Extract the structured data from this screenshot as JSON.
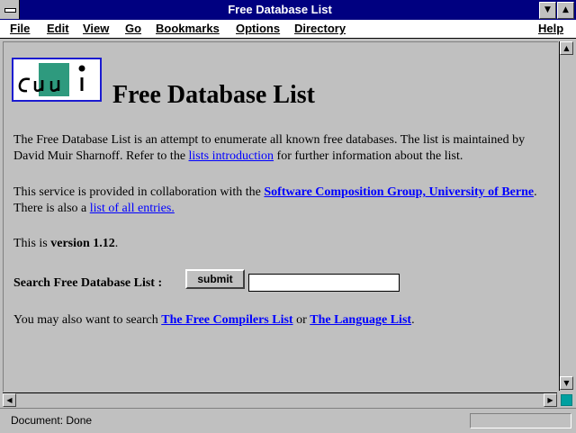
{
  "window": {
    "title": "Free Database List"
  },
  "menu": [
    "File",
    "Edit",
    "View",
    "Go",
    "Bookmarks",
    "Options",
    "Directory",
    "Help"
  ],
  "logo": {
    "text": "cui"
  },
  "page": {
    "title": "Free Database List",
    "intro": {
      "text1": "The Free Database List is an attempt to enumerate all known free databases. The list is maintained by David Muir Sharnoff. Refer to the ",
      "link": "lists introduction",
      "text2": " for further information about the list."
    },
    "collab": {
      "text1": "This service is provided in collaboration with the ",
      "link1": "Software Composition Group, University of Berne",
      "text2": ". There is also a ",
      "link2": "list of all entries.",
      "text3": ""
    },
    "version": {
      "prefix": "This is ",
      "value": "version 1.12",
      "suffix": "."
    },
    "search": {
      "label": "Search Free Database List :",
      "button": "submit",
      "value": ""
    },
    "also": {
      "text1": "You may also want to search ",
      "link1": "The Free Compilers List",
      "text2": " or ",
      "link2": "The Language List",
      "text3": "."
    }
  },
  "status": {
    "text": "Document: Done"
  },
  "colors": {
    "titlebar": "#000080",
    "link": "#0000ff",
    "background": "#c0c0c0",
    "logo_teal": "#2e9a7e"
  }
}
